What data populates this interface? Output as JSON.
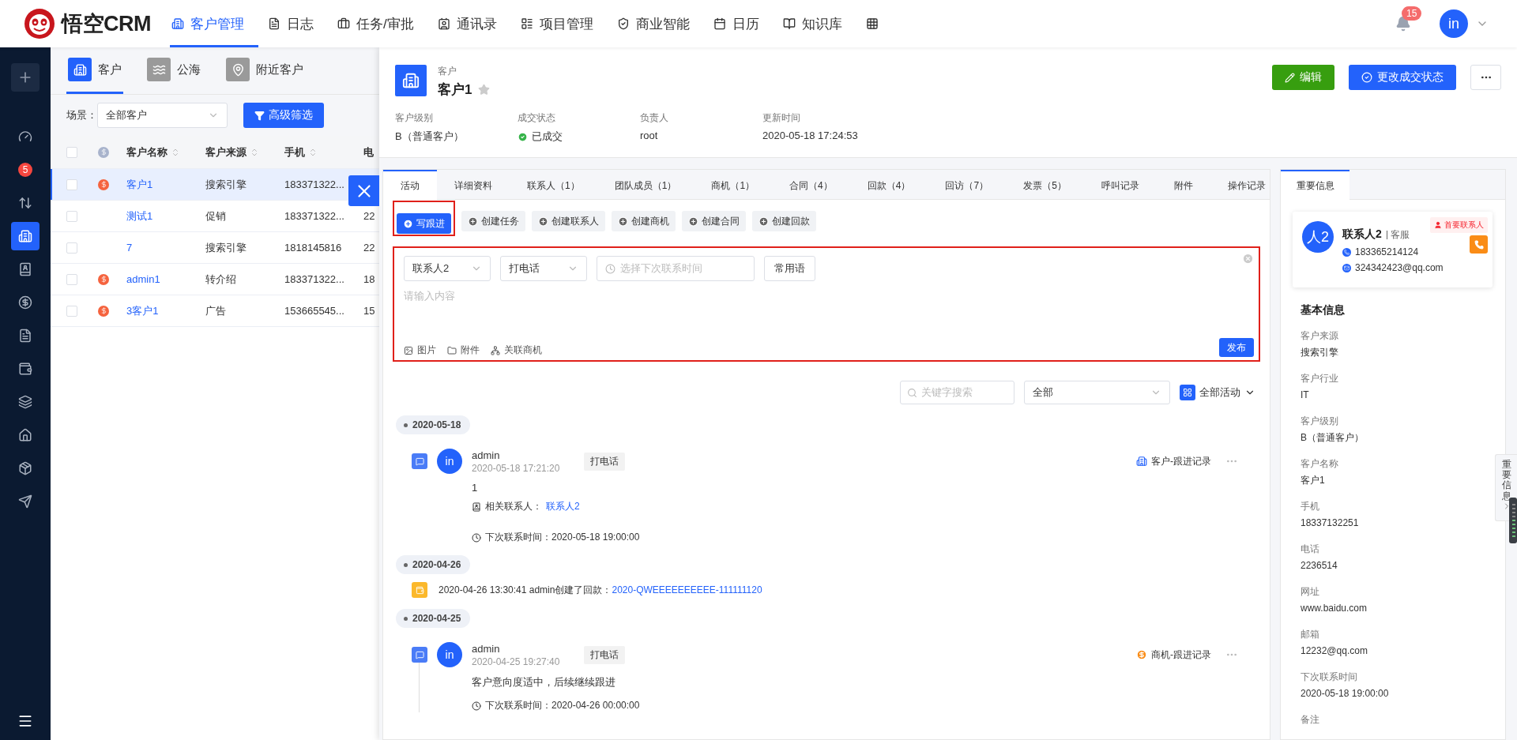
{
  "app": {
    "logo": "悟空CRM"
  },
  "nav": [
    {
      "label": "客户管理",
      "selected": true
    },
    {
      "label": "日志",
      "selected": false
    },
    {
      "label": "任务/审批",
      "selected": false
    },
    {
      "label": "通讯录",
      "selected": false
    },
    {
      "label": "项目管理",
      "selected": false
    },
    {
      "label": "商业智能",
      "selected": false
    },
    {
      "label": "日历",
      "selected": false
    },
    {
      "label": "知识库",
      "selected": false
    }
  ],
  "notifications": {
    "count": "15"
  },
  "user": {
    "avatar": "in"
  },
  "sidebar": {
    "items": [
      {
        "selected": false
      },
      {
        "selected": false,
        "badge": "5"
      },
      {
        "selected": false
      },
      {
        "selected": true
      },
      {
        "selected": false
      },
      {
        "selected": false
      },
      {
        "selected": false
      },
      {
        "selected": false
      },
      {
        "selected": false
      },
      {
        "selected": false
      },
      {
        "selected": false
      },
      {
        "selected": false
      }
    ]
  },
  "list_tabs": [
    {
      "label": "客户",
      "selected": true
    },
    {
      "label": "公海",
      "selected": false
    },
    {
      "label": "附近客户",
      "selected": false
    }
  ],
  "filter": {
    "label": "场景：",
    "scene": "全部客户",
    "button": "高级筛选"
  },
  "table": {
    "all_checked": false,
    "columns": [
      "客户名称",
      "客户来源",
      "手机",
      "电"
    ],
    "rows": [
      {
        "checked": false,
        "selected": true,
        "deal": true,
        "name": "客户1",
        "source": "搜索引擎",
        "mobile": "183371322..."
      },
      {
        "checked": false,
        "selected": false,
        "deal": false,
        "name": "测试1",
        "source": "促销",
        "mobile": "183371322...",
        "phone": "22"
      },
      {
        "checked": false,
        "selected": false,
        "deal": false,
        "name": "7",
        "source": "搜索引擎",
        "mobile": "1818145816",
        "phone": "22"
      },
      {
        "checked": false,
        "selected": false,
        "deal": true,
        "name": "admin1",
        "source": "转介绍",
        "mobile": "183371322...",
        "phone": "18"
      },
      {
        "checked": false,
        "selected": false,
        "deal": true,
        "name": "3客户1",
        "source": "广告",
        "mobile": "153665545...",
        "phone": "15"
      }
    ]
  },
  "customer": {
    "type": "客户",
    "name": "客户1",
    "starred": false,
    "fields": [
      {
        "kind": "text",
        "label": "客户级别",
        "value": "B（普通客户）"
      },
      {
        "kind": "deal",
        "label": "成交状态",
        "value": "已成交"
      },
      {
        "kind": "text",
        "label": "负责人",
        "value": "root"
      },
      {
        "kind": "text",
        "label": "更新时间",
        "value": "2020-05-18 17:24:53"
      }
    ],
    "actions": [
      {
        "kind": "edit",
        "label": "编辑"
      },
      {
        "kind": "status",
        "label": "更改成交状态"
      }
    ]
  },
  "detail_tabs": [
    {
      "label": "活动",
      "selected": true
    },
    {
      "label": "详细资料",
      "selected": false
    },
    {
      "label": "联系人（1）",
      "selected": false
    },
    {
      "label": "团队成员（1）",
      "selected": false
    },
    {
      "label": "商机（1）",
      "selected": false
    },
    {
      "label": "合同（4）",
      "selected": false
    },
    {
      "label": "回款（4）",
      "selected": false
    },
    {
      "label": "回访（7）",
      "selected": false
    },
    {
      "label": "发票（5）",
      "selected": false
    },
    {
      "label": "呼叫记录",
      "selected": false
    },
    {
      "label": "附件",
      "selected": false
    },
    {
      "label": "操作记录",
      "selected": false
    }
  ],
  "quick_actions": [
    {
      "label": "写跟进",
      "selected": true
    },
    {
      "label": "创建任务",
      "selected": false
    },
    {
      "label": "创建联系人",
      "selected": false
    },
    {
      "label": "创建商机",
      "selected": false
    },
    {
      "label": "创建合同",
      "selected": false
    },
    {
      "label": "创建回款",
      "selected": false
    }
  ],
  "editor": {
    "contact": "联系人2",
    "method": "打电话",
    "time_placeholder": "选择下次联系时间",
    "phrases": "常用语",
    "placeholder": "请输入内容",
    "attachments": [
      "图片",
      "附件",
      "关联商机"
    ],
    "submit": "发布"
  },
  "timeline_tools": {
    "search_placeholder": "关键字搜索",
    "type": "全部",
    "view": "全部活动"
  },
  "timeline": [
    {
      "date": "2020-05-18",
      "entries": [
        {
          "kind": "followup",
          "avatar": "in",
          "author": "admin",
          "time": "2020-05-18 17:21:20",
          "method": "打电话",
          "source": {
            "kind": "customer",
            "label": "客户-跟进记录"
          },
          "content": "1",
          "contact_label": "相关联系人：",
          "contact": "联系人2",
          "next": "下次联系时间：2020-05-18 19:00:00"
        }
      ]
    },
    {
      "date": "2020-04-26",
      "entries": [
        {
          "kind": "event",
          "text": "2020-04-26 13:30:41 admin创建了回款：",
          "link": "2020-QWEEEEEEEEEE-111111120"
        }
      ]
    },
    {
      "date": "2020-04-25",
      "entries": [
        {
          "kind": "followup",
          "avatar": "in",
          "author": "admin",
          "time": "2020-04-25 19:27:40",
          "method": "打电话",
          "source": {
            "kind": "deal",
            "label": "商机-跟进记录"
          },
          "content": "客户意向度适中，后续继续跟进",
          "next": "下次联系时间：2020-04-26 00:00:00"
        }
      ]
    }
  ],
  "side_panel": {
    "tab": {
      "label": "重要信息",
      "selected": true
    },
    "contact": {
      "avatar": "人2",
      "name": "联系人2",
      "role": "客服",
      "badge": "首要联系人",
      "phone": "183365214124",
      "email": "324342423@qq.com"
    },
    "section": "基本信息",
    "fields": [
      {
        "label": "客户来源",
        "value": "搜索引擎"
      },
      {
        "label": "客户行业",
        "value": "IT"
      },
      {
        "label": "客户级别",
        "value": "B（普通客户）"
      },
      {
        "label": "客户名称",
        "value": "客户1"
      },
      {
        "label": "手机",
        "value": "18337132251"
      },
      {
        "label": "电话",
        "value": "2236514"
      },
      {
        "label": "网址",
        "value": "www.baidu.com"
      },
      {
        "label": "邮箱",
        "value": "12232@qq.com"
      },
      {
        "label": "下次联系时间",
        "value": "2020-05-18 19:00:00"
      },
      {
        "label": "备注"
      }
    ],
    "drawer_tab": "重要信息"
  }
}
